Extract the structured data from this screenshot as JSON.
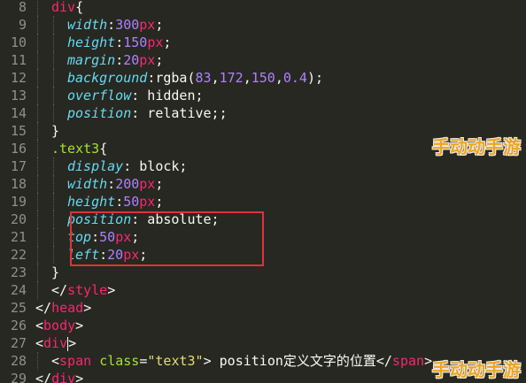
{
  "editor": {
    "lines": [
      {
        "n": "8",
        "parts": [
          [
            "tag",
            "div"
          ],
          [
            "kw",
            "{"
          ]
        ]
      },
      {
        "n": "9",
        "parts": [
          [
            "prop",
            "width"
          ],
          [
            "kw",
            ":"
          ],
          [
            "num",
            "300"
          ],
          [
            "tag",
            "px"
          ],
          [
            "kw",
            ";"
          ]
        ]
      },
      {
        "n": "10",
        "parts": [
          [
            "prop",
            "height"
          ],
          [
            "kw",
            ":"
          ],
          [
            "num",
            "150"
          ],
          [
            "tag",
            "px"
          ],
          [
            "kw",
            ";"
          ]
        ]
      },
      {
        "n": "11",
        "parts": [
          [
            "prop",
            "margin"
          ],
          [
            "kw",
            ":"
          ],
          [
            "num",
            "20"
          ],
          [
            "tag",
            "px"
          ],
          [
            "kw",
            ";"
          ]
        ]
      },
      {
        "n": "12",
        "parts": [
          [
            "prop",
            "background"
          ],
          [
            "kw",
            ":rgba("
          ],
          [
            "num",
            "83"
          ],
          [
            "kw",
            ","
          ],
          [
            "num",
            "172"
          ],
          [
            "kw",
            ","
          ],
          [
            "num",
            "150"
          ],
          [
            "kw",
            ","
          ],
          [
            "num",
            "0.4"
          ],
          [
            "kw",
            ");"
          ]
        ]
      },
      {
        "n": "13",
        "parts": [
          [
            "prop",
            "overflow"
          ],
          [
            "kw",
            ": hidden;"
          ]
        ]
      },
      {
        "n": "14",
        "parts": [
          [
            "prop",
            "position"
          ],
          [
            "kw",
            ": relative;;"
          ]
        ]
      },
      {
        "n": "15",
        "parts": [
          [
            "kw",
            "}"
          ]
        ]
      },
      {
        "n": "16",
        "parts": [
          [
            "sel",
            ".text3"
          ],
          [
            "kw",
            "{"
          ]
        ]
      },
      {
        "n": "17",
        "parts": [
          [
            "prop",
            "display"
          ],
          [
            "kw",
            ": block;"
          ]
        ]
      },
      {
        "n": "18",
        "parts": [
          [
            "prop",
            "width"
          ],
          [
            "kw",
            ":"
          ],
          [
            "num",
            "200"
          ],
          [
            "tag",
            "px"
          ],
          [
            "kw",
            ";"
          ]
        ]
      },
      {
        "n": "19",
        "parts": [
          [
            "prop",
            "height"
          ],
          [
            "kw",
            ":"
          ],
          [
            "num",
            "50"
          ],
          [
            "tag",
            "px"
          ],
          [
            "kw",
            ";"
          ]
        ]
      },
      {
        "n": "20",
        "parts": [
          [
            "prop",
            "position"
          ],
          [
            "kw",
            ": absolute;"
          ]
        ]
      },
      {
        "n": "21",
        "parts": [
          [
            "prop",
            "top"
          ],
          [
            "kw",
            ":"
          ],
          [
            "num",
            "50"
          ],
          [
            "tag",
            "px"
          ],
          [
            "kw",
            ";"
          ]
        ]
      },
      {
        "n": "22",
        "parts": [
          [
            "prop",
            "left"
          ],
          [
            "kw",
            ":"
          ],
          [
            "num",
            "20"
          ],
          [
            "tag",
            "px"
          ],
          [
            "kw",
            ";"
          ]
        ]
      },
      {
        "n": "23",
        "parts": [
          [
            "kw",
            "}"
          ]
        ]
      },
      {
        "n": "24",
        "parts": [
          [
            "kw",
            "</"
          ],
          [
            "tag",
            "style"
          ],
          [
            "kw",
            ">"
          ]
        ]
      },
      {
        "n": "25",
        "parts": [
          [
            "kw",
            "</"
          ],
          [
            "tag",
            "head"
          ],
          [
            "kw",
            ">"
          ]
        ]
      },
      {
        "n": "26",
        "parts": [
          [
            "kw",
            "<"
          ],
          [
            "tag",
            "body"
          ],
          [
            "kw",
            ">"
          ]
        ]
      },
      {
        "n": "27",
        "parts": [
          [
            "kw",
            "<"
          ],
          [
            "tag",
            "div"
          ],
          [
            "kw",
            ">"
          ]
        ]
      },
      {
        "n": "28",
        "parts": [
          [
            "kw",
            "<"
          ],
          [
            "tag",
            "span"
          ],
          [
            "kw",
            " "
          ],
          [
            "attr",
            "class"
          ],
          [
            "kw",
            "="
          ],
          [
            "str",
            "\"text3\""
          ],
          [
            "kw",
            "> position定义文字的位置</"
          ],
          [
            "tag",
            "span"
          ],
          [
            "kw",
            ">"
          ]
        ]
      },
      {
        "n": "29",
        "parts": [
          [
            "kw",
            "</"
          ],
          [
            "tag",
            "div"
          ],
          [
            "kw",
            ">"
          ]
        ]
      }
    ],
    "indent": [
      1,
      2,
      2,
      2,
      2,
      2,
      2,
      1,
      1,
      2,
      2,
      2,
      2,
      2,
      2,
      1,
      1,
      0,
      0,
      0,
      1,
      0
    ]
  },
  "watermark": {
    "text": "手动动手游"
  },
  "colors": {
    "background": "#272822",
    "tag": "#f92672",
    "property": "#66d9ef",
    "number": "#ae81ff",
    "string": "#e6db74",
    "attribute": "#a6e22e",
    "highlight_box": "#e0323a"
  }
}
